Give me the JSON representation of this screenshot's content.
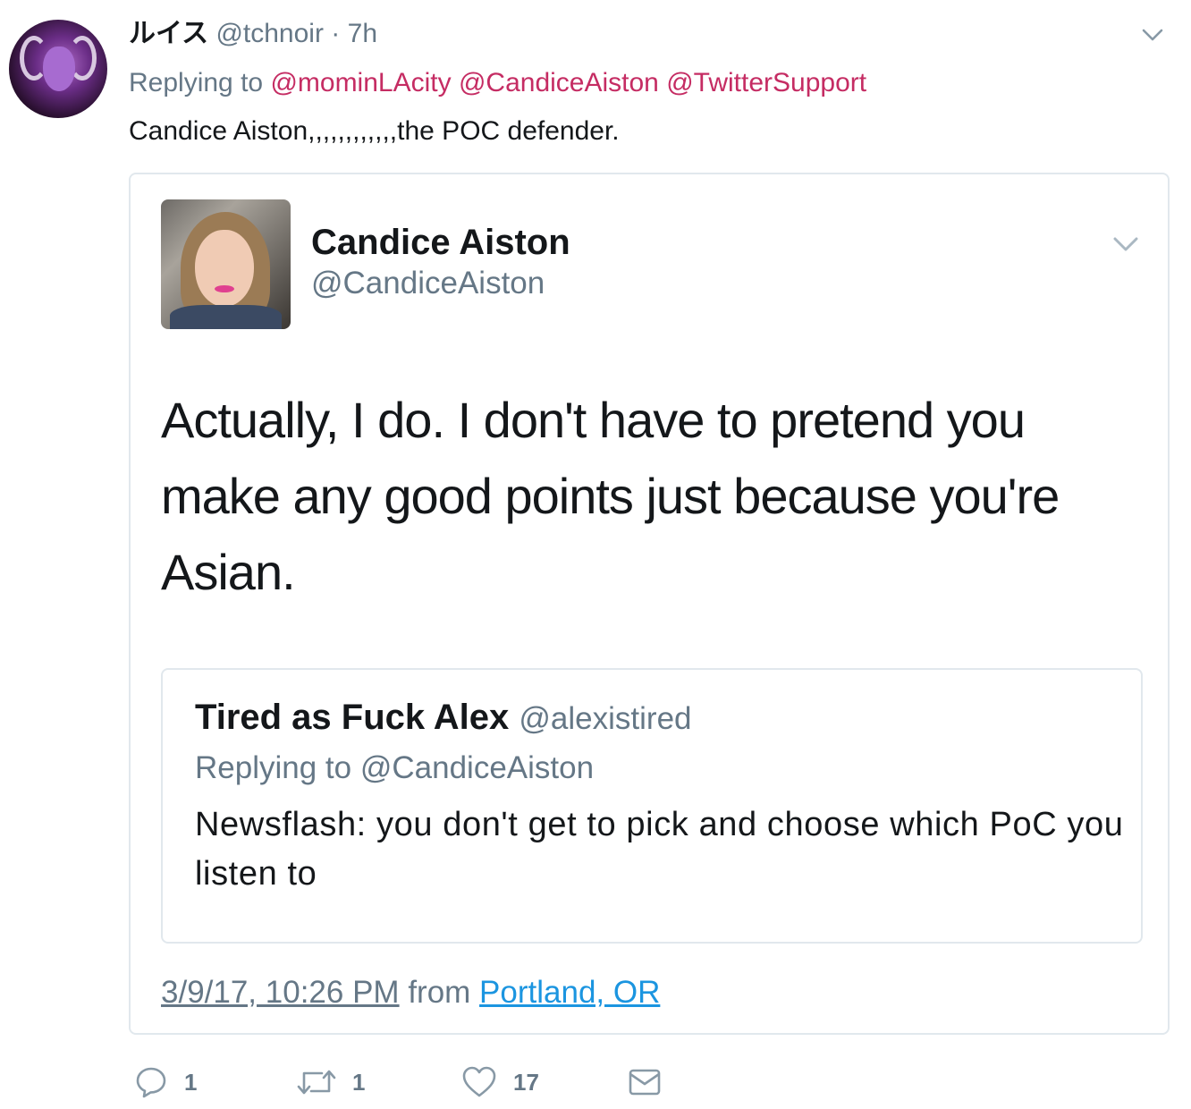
{
  "tweet": {
    "display_name": "ルイス",
    "handle": "@tchnoir",
    "separator": "·",
    "time": "7h",
    "replying_prefix": "Replying to",
    "replying_mentions": [
      "@mominLAcity",
      "@CandiceAiston",
      "@TwitterSupport"
    ],
    "text": "Candice Aiston,,,,,,,,,,,,the POC defender."
  },
  "quoted_tweet": {
    "display_name": "Candice Aiston",
    "handle": "@CandiceAiston",
    "text": "Actually, I do. I don't have to pretend you make any good points just because you're Asian.",
    "timestamp": "3/9/17, 10:26 PM",
    "from_label": "from",
    "location": "Portland, OR",
    "inner_quote": {
      "display_name": "Tired as Fuck Alex",
      "handle": "@alexistired",
      "replying_prefix": "Replying to",
      "replying_mention": "@CandiceAiston",
      "text": "Newsflash: you don't get to pick and choose which PoC you listen to"
    }
  },
  "actions": {
    "reply_count": "1",
    "retweet_count": "1",
    "like_count": "17",
    "icons": [
      "reply-icon",
      "retweet-icon",
      "like-icon",
      "message-icon"
    ]
  },
  "colors": {
    "mention": "#c52c63",
    "muted": "#657786",
    "link": "#1b95e0",
    "border": "#e1e8ed"
  }
}
